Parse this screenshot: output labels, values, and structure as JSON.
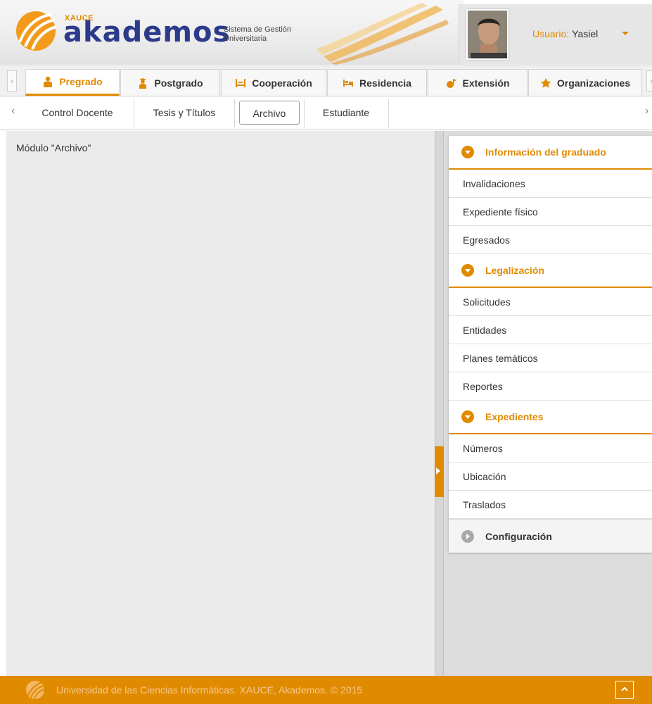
{
  "header": {
    "brand_top": "XAUCE",
    "brand_name": "akademos",
    "brand_subtitle": "Sistema de Gestión Universitaria",
    "user_label": "Usuario:",
    "user_name": "Yasiel",
    "accent_color": "#e08a00"
  },
  "modules": [
    {
      "label": "Pregrado",
      "icon": "student-icon",
      "active": true
    },
    {
      "label": "Postgrado",
      "icon": "graduate-icon",
      "active": false
    },
    {
      "label": "Cooperación",
      "icon": "cooperation-icon",
      "active": false
    },
    {
      "label": "Residencia",
      "icon": "bed-icon",
      "active": false
    },
    {
      "label": "Extensión",
      "icon": "extension-icon",
      "active": false
    },
    {
      "label": "Organizaciones",
      "icon": "star-icon",
      "active": false
    }
  ],
  "submodules": [
    {
      "label": "Control Docente",
      "active": false
    },
    {
      "label": "Tesis y Títulos",
      "active": false
    },
    {
      "label": "Archivo",
      "active": true
    },
    {
      "label": "Estudiante",
      "active": false
    }
  ],
  "content": {
    "title": "Módulo \"Archivo\""
  },
  "sidebar": {
    "sections": [
      {
        "title": "Información del graduado",
        "expanded": true,
        "items": [
          "Invalidaciones",
          "Expediente físico",
          "Egresados"
        ]
      },
      {
        "title": "Legalización",
        "expanded": true,
        "items": [
          "Solicitudes",
          "Entidades",
          "Planes temáticos",
          "Reportes"
        ]
      },
      {
        "title": "Expedientes",
        "expanded": true,
        "items": [
          "Números",
          "Ubicación",
          "Traslados"
        ]
      },
      {
        "title": "Configuración",
        "expanded": false,
        "items": []
      }
    ]
  },
  "footer": {
    "text": "Universidad de las Ciencias Informáticas. XAUCE, Akademos. © 2015"
  }
}
